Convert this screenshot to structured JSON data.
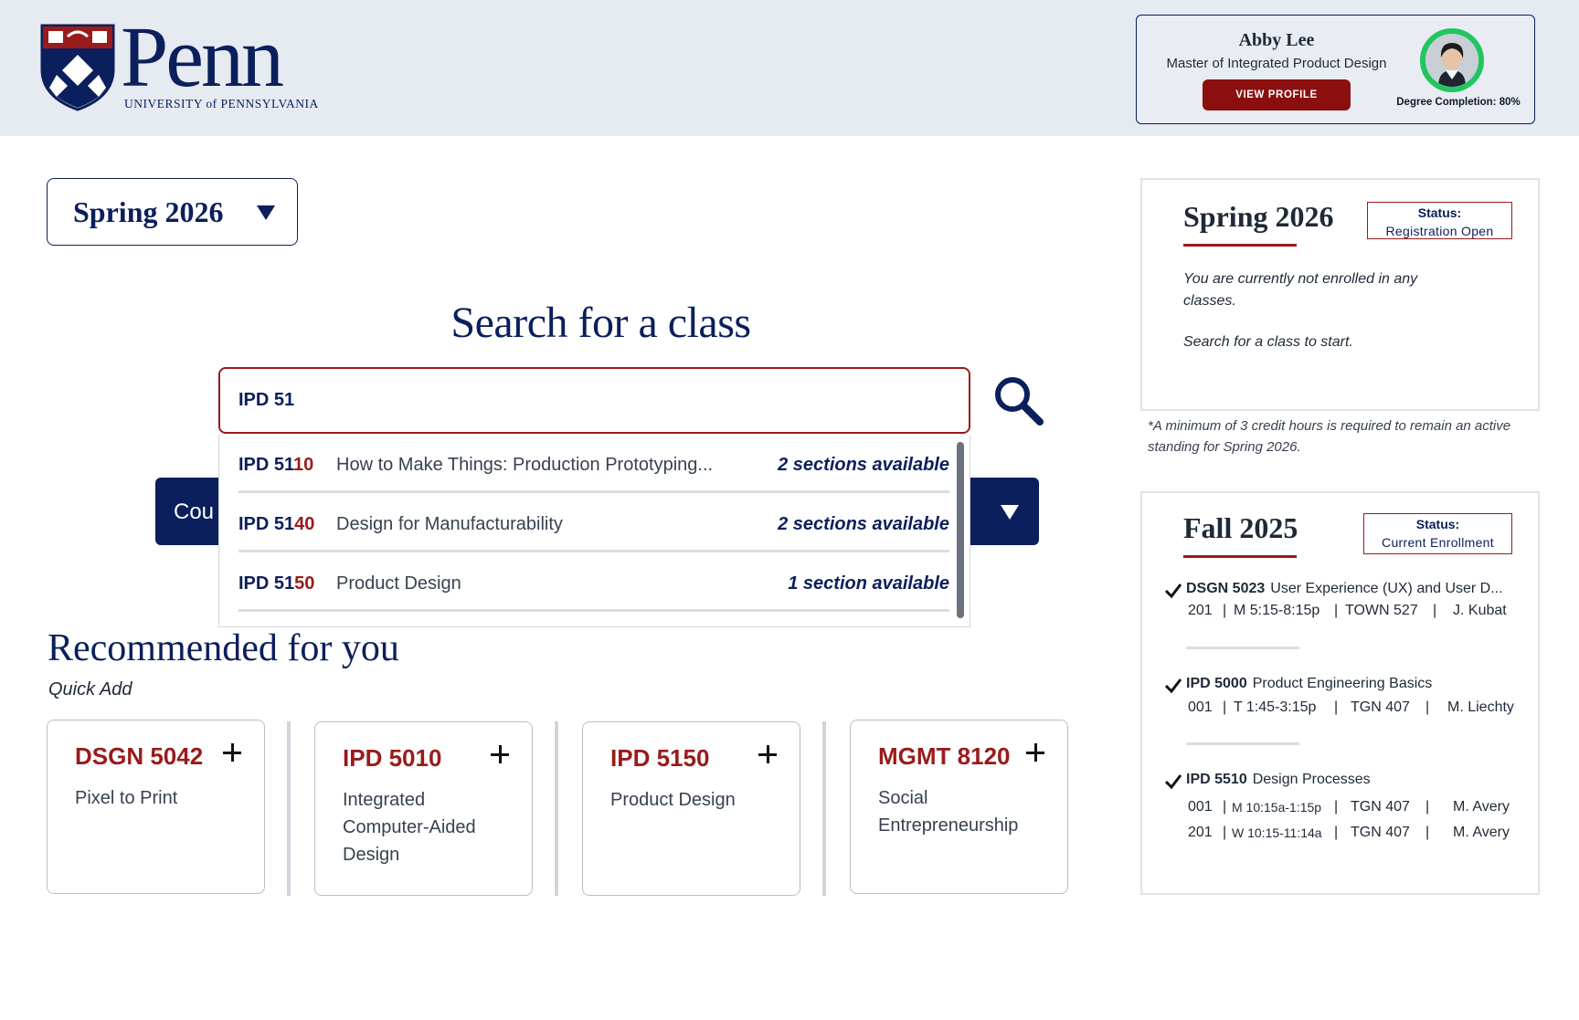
{
  "header": {
    "logo": {
      "wordmark": "Penn",
      "subtitle": "UNIVERSITY of PENNSYLVANIA"
    },
    "profile": {
      "name": "Abby Lee",
      "degree": "Master of Integrated Product Design",
      "view_profile_label": "VIEW PROFILE",
      "degree_completion": "Degree Completion: 80%",
      "degree_completion_value": 0.8
    }
  },
  "semester_select": {
    "selected": "Spring 2026"
  },
  "search": {
    "title": "Search for a class",
    "query": "IPD 51",
    "course_dropdown_label": "Cou",
    "results": [
      {
        "code_prefix": "IPD 51",
        "code_rest": "10",
        "title": "How to Make Things: Production Prototyping...",
        "availability": "2 sections available"
      },
      {
        "code_prefix": "IPD 51",
        "code_rest": "40",
        "title": "Design for Manufacturability",
        "availability": "2 sections available"
      },
      {
        "code_prefix": "IPD 51",
        "code_rest": "50",
        "title": "Product Design",
        "availability": "1 section available"
      }
    ]
  },
  "recommended": {
    "title": "Recommended for you",
    "subtitle": "Quick Add",
    "courses": [
      {
        "code": "DSGN 5042",
        "name": "Pixel to Print"
      },
      {
        "code": "IPD 5010",
        "name": "Integrated Computer-Aided Design"
      },
      {
        "code": "IPD 5150",
        "name": "Product Design"
      },
      {
        "code": "MGMT 8120",
        "name": "Social Entrepreneurship"
      }
    ]
  },
  "spring_panel": {
    "term": "Spring 2026",
    "status_label": "Status:",
    "status_value": "Registration Open",
    "message": "You are currently not enrolled in any classes.",
    "cta": "Search for a class to start.",
    "note": "*A minimum of 3 credit hours is required to remain an active standing for Spring 2026."
  },
  "fall_panel": {
    "term": "Fall 2025",
    "status_label": "Status:",
    "status_value": "Current Enrollment",
    "enrollments": [
      {
        "code": "DSGN 5023",
        "title": "User Experience (UX) and User D...",
        "sections": [
          {
            "section": "201",
            "sep1": "|",
            "time": "M 5:15-8:15p",
            "sep2": "|",
            "room": "TOWN 527",
            "sep3": "|",
            "instructor": "J. Kubat"
          }
        ]
      },
      {
        "code": "IPD 5000",
        "title": "Product Engineering Basics",
        "sections": [
          {
            "section": "001",
            "sep1": "|",
            "time": "T 1:45-3:15p",
            "sep2": "|",
            "room": "TGN 407",
            "sep3": "|",
            "instructor": "M. Liechty"
          }
        ]
      },
      {
        "code": "IPD 5510",
        "title": "Design Processes",
        "sections": [
          {
            "section": "001",
            "sep1": "|",
            "time": "M 10:15a-1:15p",
            "sep2": "|",
            "room": "TGN 407",
            "sep3": "|",
            "instructor": "M. Avery"
          },
          {
            "section": "201",
            "sep1": "|",
            "time": "W 10:15-11:14a",
            "sep2": "|",
            "room": "TGN 407",
            "sep3": "|",
            "instructor": "M. Avery"
          }
        ]
      }
    ]
  },
  "colors": {
    "navy": "#0b1f5c",
    "penn_red": "#991b1b",
    "completion_ring": "#22c55e",
    "header_bg": "#e6eaf1"
  }
}
